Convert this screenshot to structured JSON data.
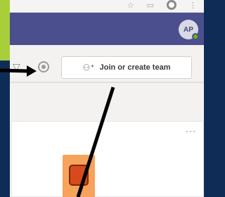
{
  "browser": {
    "icons": [
      "star-icon",
      "menu-icon",
      "profile-icon",
      "more-vertical-icon"
    ]
  },
  "header": {
    "avatar_initials": "AP",
    "presence_color": "#6bb700",
    "brand_color": "#4b4f8e"
  },
  "toolbar": {
    "join_label": "Join or create team",
    "join_icon": "people-add-icon"
  },
  "team_card": {
    "more_label": "···"
  },
  "annotations": {
    "arrow_color": "#000000"
  }
}
